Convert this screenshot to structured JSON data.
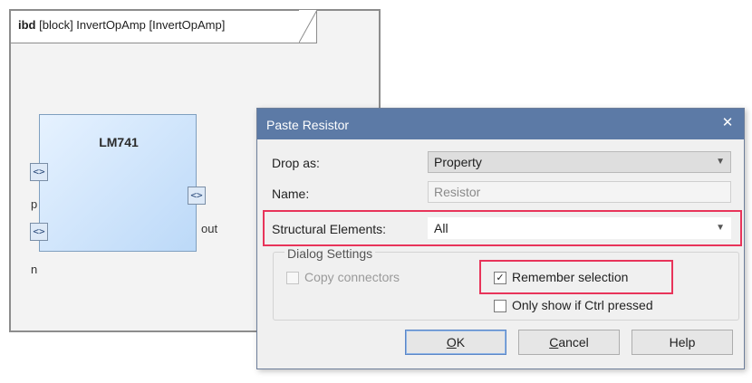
{
  "diagram": {
    "frame_kind": "ibd",
    "frame_title": "[block] InvertOpAmp [InvertOpAmp]",
    "block": {
      "name": "LM741",
      "port_glyph": "<>",
      "ports": [
        {
          "label": "p"
        },
        {
          "label": "n"
        },
        {
          "label": "out"
        }
      ]
    }
  },
  "dialog": {
    "title": "Paste Resistor",
    "close_glyph": "✕",
    "fields": {
      "drop_as_label": "Drop as:",
      "drop_as_value": "Property",
      "name_label": "Name:",
      "name_value": "Resistor",
      "structural_label": "Structural Elements:",
      "structural_value": "All"
    },
    "dropdown_glyph": "▼",
    "group": {
      "legend": "Dialog Settings",
      "copy_connectors": "Copy connectors",
      "remember_selection": "Remember selection",
      "only_show_ctrl": "Only show if Ctrl pressed",
      "remember_checked": true,
      "check_glyph": "✓"
    },
    "buttons": {
      "ok": "OK",
      "cancel": "Cancel",
      "help": "Help"
    }
  },
  "colors": {
    "titlebar": "#5c7aa6",
    "highlight": "#e8345a"
  }
}
